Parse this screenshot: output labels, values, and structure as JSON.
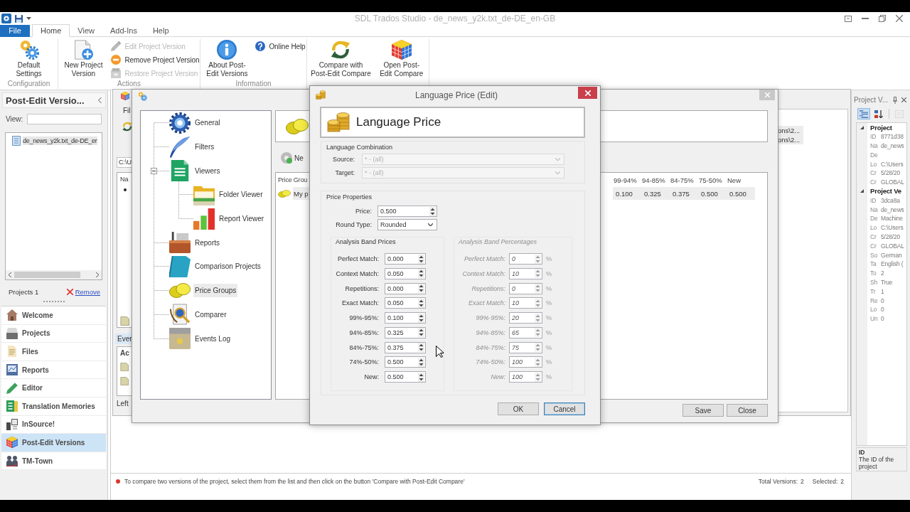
{
  "title_bar": {
    "title": "SDL Trados Studio - de_news_y2k.txt_de-DE_en-GB"
  },
  "ribbon": {
    "tabs": [
      {
        "label": "File",
        "kind": "file",
        "selected": false
      },
      {
        "label": "Home",
        "kind": "tab",
        "selected": true
      },
      {
        "label": "View",
        "kind": "tab",
        "selected": false
      },
      {
        "label": "Add-Ins",
        "kind": "tab",
        "selected": false
      },
      {
        "label": "Help",
        "kind": "tab",
        "selected": false
      }
    ],
    "groups": [
      {
        "label": "Configuration",
        "items": [
          {
            "kind": "large",
            "label": "Default Settings",
            "disabled": false
          }
        ]
      },
      {
        "label": "Actions",
        "items": [
          {
            "kind": "large",
            "label": "New Project Version",
            "disabled": false
          },
          {
            "kind": "small",
            "label": "Edit Project Version",
            "disabled": true
          },
          {
            "kind": "small",
            "label": "Remove Project Version",
            "disabled": false
          },
          {
            "kind": "small",
            "label": "Restore Project Version",
            "disabled": true
          }
        ]
      },
      {
        "label": "Information",
        "items": [
          {
            "kind": "large",
            "label": "About Post-Edit Versions",
            "disabled": false
          },
          {
            "kind": "small",
            "label": "Online Help",
            "disabled": false
          }
        ]
      },
      {
        "items": [
          {
            "kind": "large",
            "label": "Compare with\nPost-Edit Compare",
            "disabled": false
          },
          {
            "kind": "large",
            "label": "Open Post-Edit Compare",
            "disabled": false
          }
        ]
      }
    ]
  },
  "nav_panel": {
    "title": "Post-Edit Versio...",
    "view_label": "View:",
    "projects": [
      {
        "name": "de_news_y2k.txt_de-DE_er",
        "selected": true
      }
    ],
    "project_count": "Projects 1",
    "remove_link": "Remove",
    "nav_items": [
      {
        "label": "Welcome",
        "selected": false
      },
      {
        "label": "Projects",
        "selected": false
      },
      {
        "label": "Files",
        "selected": false
      },
      {
        "label": "Reports",
        "selected": false
      },
      {
        "label": "Editor",
        "selected": false
      },
      {
        "label": "Translation Memories",
        "selected": false
      },
      {
        "label": "InSource!",
        "selected": false
      },
      {
        "label": "Post-Edit Versions",
        "selected": true
      },
      {
        "label": "TM-Town",
        "selected": false
      }
    ]
  },
  "background_window": {
    "menu_item": "Fil",
    "path_field": "C:\\U",
    "list_header": "Na",
    "panel_tab": "Ever",
    "table_header": "Ac",
    "footer_label": "Left",
    "path_rows": [
      "ons\\2...",
      "ons\\2..."
    ]
  },
  "settings_window": {
    "tree": [
      {
        "label": "General",
        "selected": false
      },
      {
        "label": "Filters",
        "selected": false
      },
      {
        "label": "Viewers",
        "selected": false,
        "expanded": true,
        "children": [
          {
            "label": "Folder Viewer",
            "selected": false
          },
          {
            "label": "Report Viewer",
            "selected": false
          }
        ]
      },
      {
        "label": "Reports",
        "selected": false
      },
      {
        "label": "Comparison Projects",
        "selected": false
      },
      {
        "label": "Price Groups",
        "selected": true
      },
      {
        "label": "Comparer",
        "selected": false
      },
      {
        "label": "Events Log",
        "selected": false
      }
    ],
    "toolbar_button": "Ne",
    "table": {
      "columns": [
        "Price Grou",
        "99-94%",
        "94-85%",
        "84-75%",
        "75-50%",
        "New"
      ],
      "rows": [
        {
          "cells": [
            "My p",
            "0.100",
            "0.325",
            "0.375",
            "0.500",
            "0.500"
          ],
          "selected": true
        }
      ]
    },
    "buttons": [
      "Save",
      "Close"
    ]
  },
  "price_dialog": {
    "title": "Language Price (Edit)",
    "heading": "Language Price",
    "language_combination": {
      "label": "Language Combination",
      "fields": [
        {
          "label": "Source:",
          "value": "* - (all)",
          "disabled": true
        },
        {
          "label": "Target:",
          "value": "* - (all)",
          "disabled": true
        }
      ]
    },
    "price_properties": {
      "label": "Price Properties",
      "price": {
        "label": "Price:",
        "value": "0.500"
      },
      "round_type": {
        "label": "Round Type:",
        "value": "Rounded"
      },
      "band_prices": {
        "label": "Analysis Band Prices",
        "disabled": false,
        "rows": [
          {
            "label": "Perfect Match:",
            "value": "0.000"
          },
          {
            "label": "Context Match:",
            "value": "0.050"
          },
          {
            "label": "Repetitions:",
            "value": "0.000"
          },
          {
            "label": "Exact Match:",
            "value": "0.050"
          },
          {
            "label": "99%-95%:",
            "value": "0.100"
          },
          {
            "label": "94%-85%:",
            "value": "0.325"
          },
          {
            "label": "84%-75%:",
            "value": "0.375"
          },
          {
            "label": "74%-50%:",
            "value": "0.500"
          },
          {
            "label": "New:",
            "value": "0.500"
          }
        ]
      },
      "band_percentages": {
        "label": "Analysis Band Percentages",
        "disabled": true,
        "rows": [
          {
            "label": "Perfect Match:",
            "value": "0",
            "unit": "%"
          },
          {
            "label": "Context Match:",
            "value": "10",
            "unit": "%"
          },
          {
            "label": "Repetitions:",
            "value": "0",
            "unit": "%"
          },
          {
            "label": "Exact Match:",
            "value": "10",
            "unit": "%"
          },
          {
            "label": "99%-95%:",
            "value": "20",
            "unit": "%"
          },
          {
            "label": "94%-85%:",
            "value": "65",
            "unit": "%"
          },
          {
            "label": "84%-75%:",
            "value": "75",
            "unit": "%"
          },
          {
            "label": "74%-50%:",
            "value": "100",
            "unit": "%"
          },
          {
            "label": "New:",
            "value": "100",
            "unit": "%"
          }
        ]
      }
    },
    "buttons": [
      {
        "label": "OK",
        "focused": false
      },
      {
        "label": "Cancel",
        "focused": true
      }
    ]
  },
  "properties_panel": {
    "title": "Project V...",
    "toolbar": [
      {
        "selected": true,
        "disabled": false
      },
      {
        "selected": false,
        "disabled": false
      },
      {
        "selected": false,
        "disabled": true
      }
    ],
    "categories": [
      {
        "label": "Project",
        "expanded": true,
        "rows": [
          {
            "name": "ID",
            "value": "8771d38"
          },
          {
            "name": "Na",
            "value": "de_news"
          },
          {
            "name": "De"
          },
          {
            "name": "Lo",
            "value": "C:\\Users"
          },
          {
            "name": "Cr",
            "value": "5/28/20"
          },
          {
            "name": "Cr",
            "value": "GLOBAL"
          }
        ]
      },
      {
        "label": "Project Ve",
        "expanded": true,
        "rows": [
          {
            "name": "ID",
            "value": "3dca8a"
          },
          {
            "name": "Na",
            "value": "de_news"
          },
          {
            "name": "De",
            "value": "Machine"
          },
          {
            "name": "Lo",
            "value": "C:\\Users"
          },
          {
            "name": "Cr",
            "value": "5/28/20"
          },
          {
            "name": "Cr",
            "value": "GLOBAL"
          },
          {
            "name": "So",
            "value": "German"
          },
          {
            "name": "Ta",
            "value": "English ("
          },
          {
            "name": "To",
            "value": "2"
          },
          {
            "name": "Sh",
            "value": "True"
          },
          {
            "name": "Tr",
            "value": "1"
          },
          {
            "name": "Re",
            "value": "0"
          },
          {
            "name": "Lo",
            "value": "0"
          },
          {
            "name": "Un",
            "value": "0"
          }
        ]
      }
    ],
    "description": {
      "title": "ID",
      "text": "The ID of the project"
    }
  },
  "status_bar": {
    "message": "To compare two versions of the project, select them from the list and then click on the button 'Compare with Post-Edit Compare'",
    "counts": [
      {
        "label": "Total Versions:",
        "value": "2"
      },
      {
        "label": "Selected:",
        "value": "2"
      }
    ]
  }
}
